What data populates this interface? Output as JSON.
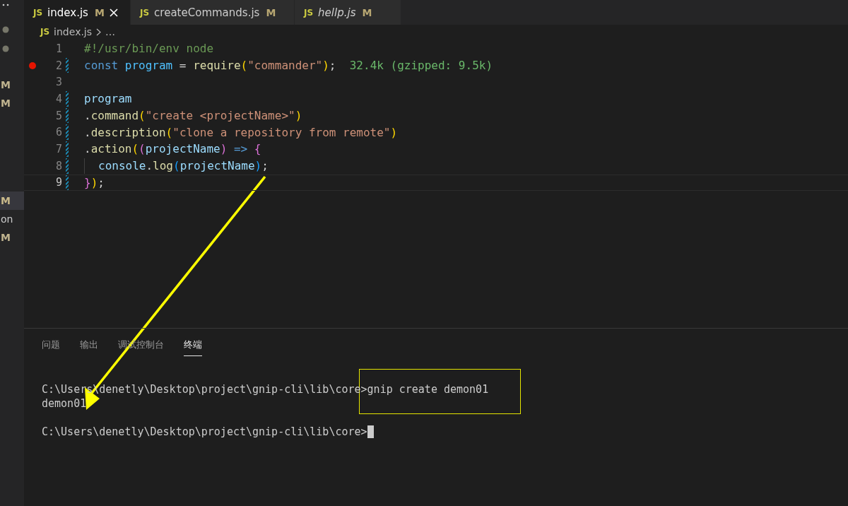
{
  "sidebar": {
    "groups": [
      [
        {
          "label": "M",
          "selected": false
        },
        {
          "label": "M",
          "selected": false
        }
      ],
      [
        {
          "label": "M",
          "selected": true
        },
        {
          "label": "on",
          "selected": false
        },
        {
          "label": "M",
          "selected": false
        }
      ]
    ]
  },
  "tabs": [
    {
      "icon": "JS",
      "label": "index.js",
      "badge": "M",
      "selected": true,
      "preview": false
    },
    {
      "icon": "JS",
      "label": "createCommands.js",
      "badge": "M",
      "selected": false,
      "preview": false
    },
    {
      "icon": "JS",
      "label": "hellp.js",
      "badge": "M",
      "selected": false,
      "preview": true
    }
  ],
  "breadcrumb": {
    "icon": "JS",
    "file": "index.js",
    "rest": "…"
  },
  "editor": {
    "lines": [
      {
        "number": "1",
        "breakpoint": false,
        "modified": false,
        "current": false,
        "indent_guide": false,
        "tokens": [
          {
            "text": "#!/usr/bin/env node",
            "kind": "comment"
          }
        ]
      },
      {
        "number": "2",
        "breakpoint": true,
        "modified": true,
        "current": false,
        "indent_guide": false,
        "tokens": [
          {
            "text": "const ",
            "kind": "keyword"
          },
          {
            "text": "program",
            "kind": "constant"
          },
          {
            "text": " = ",
            "kind": "plain"
          },
          {
            "text": "require",
            "kind": "function"
          },
          {
            "text": "(",
            "kind": "bracket1"
          },
          {
            "text": "\"commander\"",
            "kind": "string"
          },
          {
            "text": ")",
            "kind": "bracket1"
          },
          {
            "text": ";",
            "kind": "plain"
          },
          {
            "text": "  32.4k (gzipped: 9.5k)",
            "kind": "hint"
          }
        ]
      },
      {
        "number": "3",
        "breakpoint": false,
        "modified": false,
        "current": false,
        "indent_guide": false
      },
      {
        "number": "4",
        "breakpoint": false,
        "modified": true,
        "current": false,
        "indent_guide": false,
        "tokens": [
          {
            "text": "program",
            "kind": "variable"
          }
        ]
      },
      {
        "number": "5",
        "breakpoint": false,
        "modified": true,
        "current": false,
        "indent_guide": false,
        "tokens": [
          {
            "text": ".",
            "kind": "plain"
          },
          {
            "text": "command",
            "kind": "function"
          },
          {
            "text": "(",
            "kind": "bracket1"
          },
          {
            "text": "\"create <projectName>\"",
            "kind": "string"
          },
          {
            "text": ")",
            "kind": "bracket1"
          }
        ]
      },
      {
        "number": "6",
        "breakpoint": false,
        "modified": true,
        "current": false,
        "indent_guide": false,
        "tokens": [
          {
            "text": ".",
            "kind": "plain"
          },
          {
            "text": "description",
            "kind": "function"
          },
          {
            "text": "(",
            "kind": "bracket1"
          },
          {
            "text": "\"clone a repository from remote\"",
            "kind": "string"
          },
          {
            "text": ")",
            "kind": "bracket1"
          }
        ]
      },
      {
        "number": "7",
        "breakpoint": false,
        "modified": true,
        "current": false,
        "indent_guide": false,
        "tokens": [
          {
            "text": ".",
            "kind": "plain"
          },
          {
            "text": "action",
            "kind": "function"
          },
          {
            "text": "(",
            "kind": "bracket1"
          },
          {
            "text": "(",
            "kind": "bracket2"
          },
          {
            "text": "projectName",
            "kind": "variable"
          },
          {
            "text": ") ",
            "kind": "bracket2"
          },
          {
            "text": "=> ",
            "kind": "keyword"
          },
          {
            "text": "{",
            "kind": "bracket2"
          }
        ]
      },
      {
        "number": "8",
        "breakpoint": false,
        "modified": true,
        "current": false,
        "indent_guide": true,
        "tokens": [
          {
            "text": "console",
            "kind": "variable"
          },
          {
            "text": ".",
            "kind": "plain"
          },
          {
            "text": "log",
            "kind": "function"
          },
          {
            "text": "(",
            "kind": "bracket3"
          },
          {
            "text": "projectName",
            "kind": "variable"
          },
          {
            "text": ")",
            "kind": "bracket3"
          },
          {
            "text": ";",
            "kind": "plain"
          }
        ]
      },
      {
        "number": "9",
        "breakpoint": false,
        "modified": true,
        "current": true,
        "indent_guide": false,
        "tokens": [
          {
            "text": "}",
            "kind": "bracket2"
          },
          {
            "text": ")",
            "kind": "bracket1"
          },
          {
            "text": ";",
            "kind": "plain"
          }
        ]
      }
    ]
  },
  "panel": {
    "tabs": [
      {
        "label": "问题",
        "selected": false
      },
      {
        "label": "输出",
        "selected": false
      },
      {
        "label": "调试控制台",
        "selected": false
      },
      {
        "label": "终端",
        "selected": true
      }
    ],
    "terminal": {
      "lines": [
        {
          "kind": "command",
          "prompt": "C:\\Users\\denetly\\Desktop\\project\\gnip-cli\\lib\\core>",
          "command": "gnip create demon01"
        },
        {
          "kind": "output",
          "text": "demon01"
        },
        {
          "kind": "blank"
        },
        {
          "kind": "prompt",
          "prompt": "C:\\Users\\denetly\\Desktop\\project\\gnip-cli\\lib\\core>"
        }
      ]
    }
  }
}
